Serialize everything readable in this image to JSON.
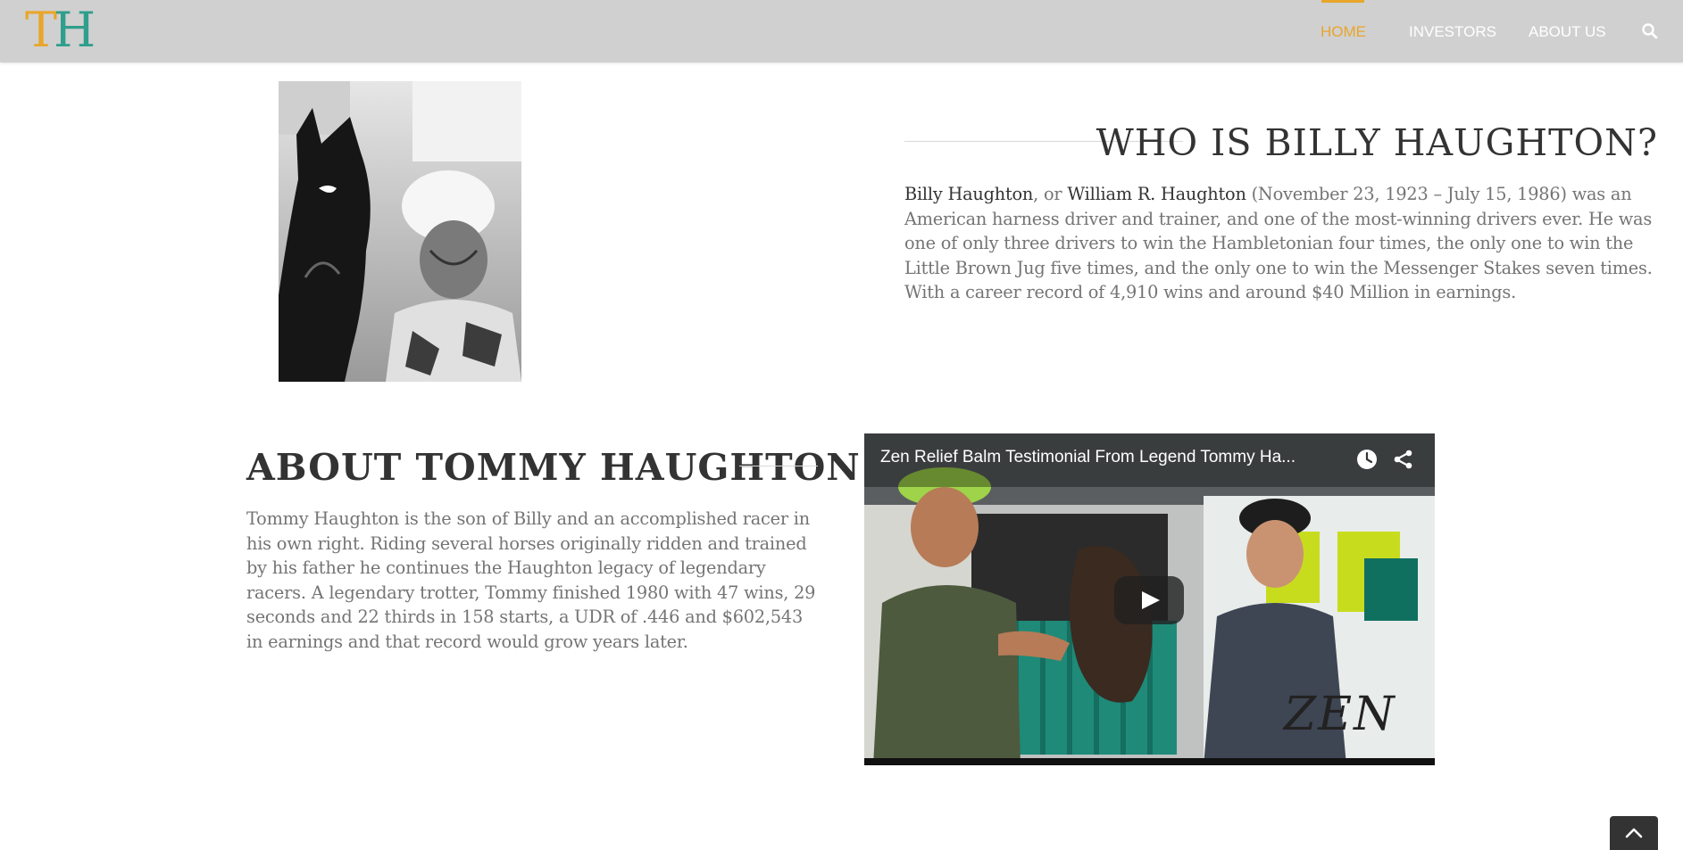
{
  "header": {
    "logo": {
      "letter1": "T",
      "letter2": "H"
    },
    "nav": [
      {
        "label": "HOME",
        "active": true
      },
      {
        "label": "INVESTORS",
        "active": false
      },
      {
        "label": "ABOUT US",
        "active": false
      }
    ],
    "search_icon": "search-icon",
    "accent_color": "#e8a62b"
  },
  "billy": {
    "title": "WHO IS BILLY HAUGHTON?",
    "name1": "Billy Haughton",
    "sep": ", or ",
    "name2": "William R. Haughton",
    "body": " (November 23, 1923 – July 15, 1986) was an American harness driver and trainer, and one of the most-winning drivers ever. He was one of only three drivers to win the Hambletonian four times, the only one to win the Little Brown Jug five times, and the only one to win the Messenger Stakes seven times. With a career record of 4,910 wins and around $40 Million in earnings."
  },
  "tommy": {
    "title": "ABOUT TOMMY HAUGHTON",
    "body": "Tommy Haughton is the son of Billy and an accomplished racer in his own right. Riding several horses originally ridden and trained by his father he continues the Haughton legacy of legendary racers. A legendary trotter, Tommy finished 1980 with 47 wins, 29 seconds and 22 thirds in 158 starts, a UDR of .446 and $602,543 in earnings and that record would grow years later."
  },
  "video": {
    "title": "Zen Relief Balm Testimonial From Legend Tommy Ha...",
    "brand_text": "ZEN",
    "icons": [
      "clock-icon",
      "share-icon",
      "play-icon"
    ]
  },
  "back_to_top_icon": "chevron-up-icon"
}
